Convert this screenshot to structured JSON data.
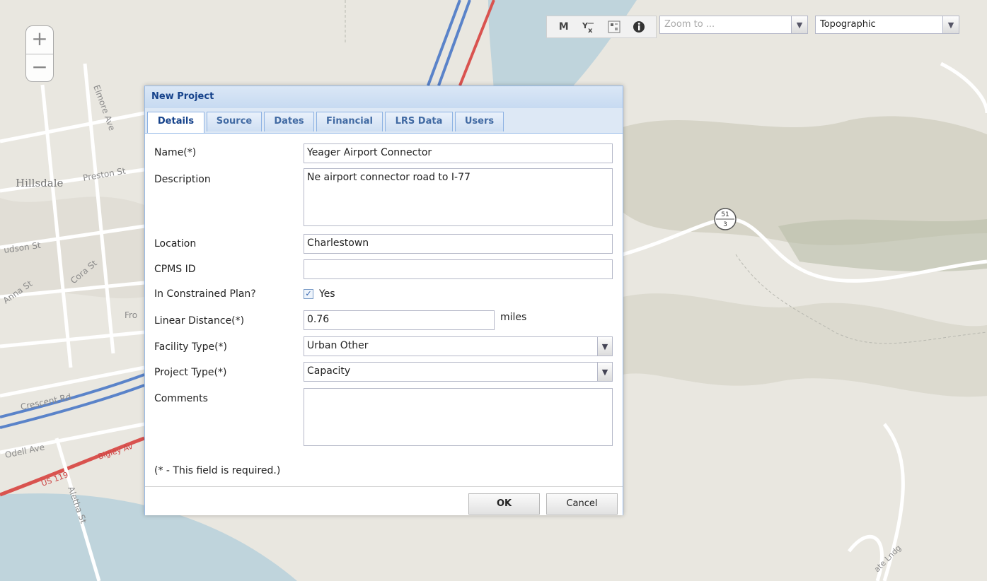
{
  "map": {
    "labels": {
      "hillsdale": "Hillsdale",
      "preston": "Preston St",
      "elmore": "Elmore Ave",
      "hudson": "udson St",
      "cora": "Cora St",
      "anna": "Anna St",
      "crescent": "Crescent Rd",
      "odell": "Odell Ave",
      "aletha": "Aletha St",
      "bigley": "Bigley Av",
      "us119": "US 119",
      "route_top": "51",
      "route_bottom": "3",
      "fro": "Fro",
      "ldg": "ate Lndg"
    },
    "colors": {
      "water": "#bfd4dc",
      "land": "#e9e7e0",
      "road_blue": "#5a83c9",
      "road_red": "#d9534f"
    }
  },
  "zoom": {
    "plus": "+",
    "minus": "−"
  },
  "toolbar": {
    "measure": "M",
    "coords_icon": "coordinates-icon",
    "legend_icon": "legend-icon",
    "info_icon": "info-icon"
  },
  "zoom_to": {
    "placeholder": "Zoom to ..."
  },
  "basemap": {
    "value": "Topographic"
  },
  "dialog": {
    "title": "New Project",
    "tabs": [
      "Details",
      "Source",
      "Dates",
      "Financial",
      "LRS Data",
      "Users"
    ],
    "fields": {
      "name_label": "Name(*)",
      "name_value": "Yeager Airport Connector",
      "description_label": "Description",
      "description_value": "Ne airport connector road to I-77",
      "location_label": "Location",
      "location_value": "Charlestown",
      "cpms_label": "CPMS ID",
      "cpms_value": "",
      "constrained_label": "In Constrained Plan?",
      "constrained_checked": true,
      "constrained_yes": "Yes",
      "distance_label": "Linear Distance(*)",
      "distance_value": "0.76",
      "distance_unit": "miles",
      "facility_label": "Facility Type(*)",
      "facility_value": "Urban Other",
      "project_label": "Project Type(*)",
      "project_value": "Capacity",
      "comments_label": "Comments",
      "comments_value": ""
    },
    "required_note": "(* - This field is required.)",
    "ok_label": "OK",
    "cancel_label": "Cancel"
  }
}
